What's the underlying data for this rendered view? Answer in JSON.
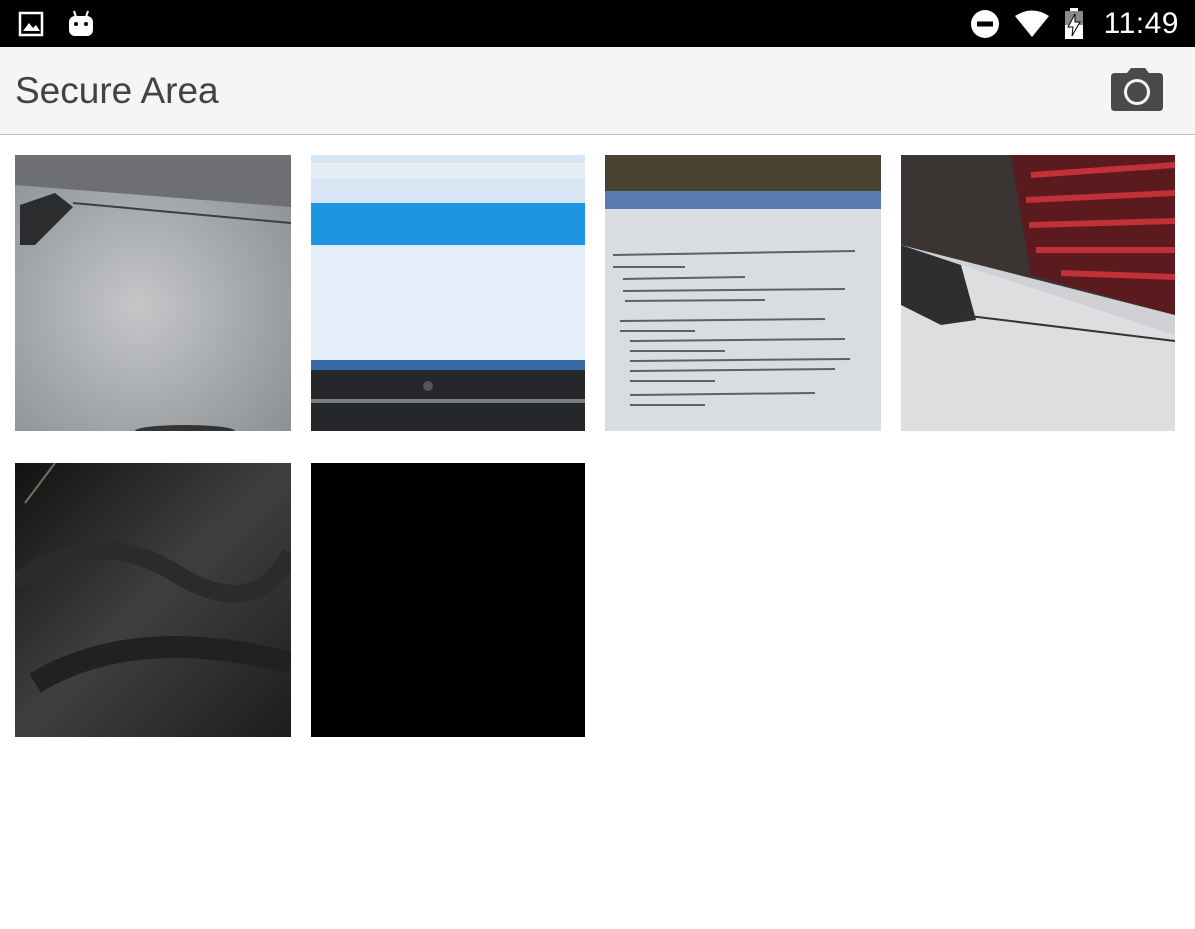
{
  "status_bar": {
    "time": "11:49",
    "left_icons": [
      "gallery-notification-icon",
      "android-debug-icon"
    ],
    "right_icons": [
      "do-not-disturb-icon",
      "wifi-icon",
      "battery-charging-icon"
    ]
  },
  "app_bar": {
    "title": "Secure Area",
    "action_icon": "camera-icon"
  },
  "gallery": {
    "photos": [
      {
        "subject": "gray speckled desk surface"
      },
      {
        "subject": "laptop screen with blue web page"
      },
      {
        "subject": "laptop screen with assignment text"
      },
      {
        "subject": "desk edge with red striped shirt"
      },
      {
        "subject": "dark fabric close-up"
      },
      {
        "subject": "black photo"
      }
    ]
  },
  "colors": {
    "status_bar": "#000000",
    "app_bar": "#f5f5f5",
    "title_text": "#424242",
    "camera_icon": "#4a4a4a",
    "background": "#ffffff"
  }
}
